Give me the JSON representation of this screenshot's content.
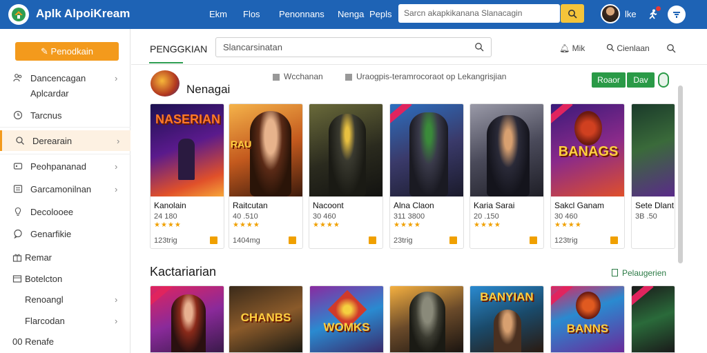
{
  "topbar": {
    "app_title": "Aplk AlpoiKream",
    "nav": [
      "Ekm",
      "Flos",
      "Penonnans",
      "Nenga",
      "Pepls"
    ],
    "search": {
      "placeholder": "Sarcn akapkikanana  Slanacagin"
    },
    "user_name": "lke",
    "colors": {
      "bar": "#1e63b5",
      "search_button": "#f4c43a"
    }
  },
  "sidebar": {
    "primary_button": "Penodkain",
    "items": [
      {
        "label": "Dancencagan",
        "icon": "people-icon",
        "chevron": true
      },
      {
        "label": "Aplcardar",
        "icon": "",
        "chevron": false
      },
      {
        "label": "Tarcnus",
        "icon": "clock-icon",
        "chevron": false
      },
      {
        "label": "Derearain",
        "icon": "search-icon",
        "chevron": true,
        "active": true
      },
      {
        "label": "Peohpananad",
        "icon": "card-icon",
        "chevron": true
      },
      {
        "label": "Garcamonilnan",
        "icon": "list-icon",
        "chevron": true
      },
      {
        "label": "Decolooee",
        "icon": "bulb-icon",
        "chevron": false
      },
      {
        "label": "Genarfikie",
        "icon": "chat-icon",
        "chevron": false
      },
      {
        "label": "Remar",
        "icon": "gift-icon",
        "chevron": false
      },
      {
        "label": "Botelcton",
        "icon": "box-icon",
        "chevron": false
      },
      {
        "label": "Renoangl",
        "icon": "",
        "chevron": true
      },
      {
        "label": "Flarcodan",
        "icon": "",
        "chevron": true
      },
      {
        "label": "00 Renafe",
        "icon": "",
        "chevron": false
      }
    ]
  },
  "header": {
    "tab": "PENGGKIAN",
    "filter_placeholder": "Slancarsinatan",
    "links": [
      "Mik",
      "Cienlaan"
    ]
  },
  "section1": {
    "title": "Nenagai",
    "checks": [
      "Wcchanan",
      "Uraogpis-teramrocoraot op Lekangrisjian"
    ],
    "buttons": [
      "Roaor",
      "Dav"
    ]
  },
  "cards": [
    {
      "name": "Kanolain",
      "size": "24 180",
      "meta": "123trig",
      "art": "NASERIAN"
    },
    {
      "name": "Raitcutan",
      "size": "40 .510",
      "meta": "1404mg",
      "art": "RAU"
    },
    {
      "name": "Nacoont",
      "size": "30 460",
      "meta": "",
      "art": ""
    },
    {
      "name": "Alna Claon",
      "size": "311 3800",
      "meta": "23trig",
      "art": ""
    },
    {
      "name": "Karia Sarai",
      "size": "20 .150",
      "meta": "",
      "art": ""
    },
    {
      "name": "Sakcl Ganam",
      "size": "30 460",
      "meta": "123trig",
      "art": "BANAGS"
    },
    {
      "name": "Sete Dlant",
      "size": "3B .50",
      "meta": "",
      "art": ""
    }
  ],
  "section2": {
    "title": "Kactariarian",
    "see_all": "Pelaugerien"
  },
  "cards2": [
    {
      "art": ""
    },
    {
      "art": "CHANBS"
    },
    {
      "art": "WOMKS"
    },
    {
      "art": ""
    },
    {
      "art": "BANYIAN"
    },
    {
      "art": "BANNS"
    },
    {
      "art": ""
    }
  ],
  "colors": {
    "accent": "#f39a1c",
    "green": "#2a9a47",
    "stars": "#f0a000"
  }
}
